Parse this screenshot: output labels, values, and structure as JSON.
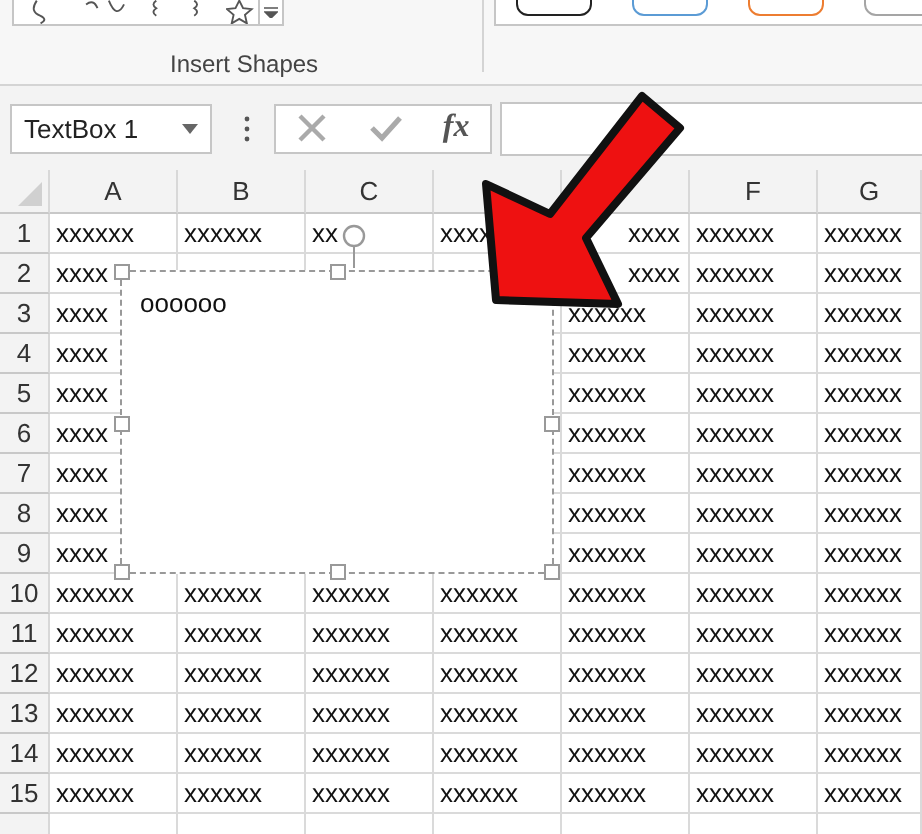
{
  "ribbon": {
    "group_label": "Insert Shapes",
    "style_swatches": [
      {
        "color": "#222222"
      },
      {
        "color": "#5b9bd5"
      },
      {
        "color": "#ed7d31"
      },
      {
        "color": "#a5a5a5"
      }
    ]
  },
  "formula_bar": {
    "name_box": "TextBox 1",
    "function_label": "fx"
  },
  "columns": [
    {
      "label": "A"
    },
    {
      "label": "B"
    },
    {
      "label": "C"
    },
    {},
    {},
    {
      "label": "F"
    },
    {
      "label": "G"
    }
  ],
  "rows": [
    {
      "number": "1",
      "cells": [
        "xxxxxx",
        "xxxxxx",
        "xx",
        "xxxx",
        "xxxx",
        "xxxxxx",
        "xxxxxx"
      ]
    },
    {
      "number": "2",
      "cells": [
        "xxxx",
        null,
        null,
        null,
        "xxxx",
        "xxxxxx",
        "xxxxxx"
      ]
    },
    {
      "number": "3",
      "cells": [
        "xxxx",
        null,
        null,
        null,
        "xxxxxx",
        "xxxxxx",
        "xxxxxx"
      ]
    },
    {
      "number": "4",
      "cells": [
        "xxxx",
        null,
        null,
        null,
        "xxxxxx",
        "xxxxxx",
        "xxxxxx"
      ]
    },
    {
      "number": "5",
      "cells": [
        "xxxx",
        null,
        null,
        null,
        "xxxxxx",
        "xxxxxx",
        "xxxxxx"
      ]
    },
    {
      "number": "6",
      "cells": [
        "xxxx",
        null,
        null,
        null,
        "xxxxxx",
        "xxxxxx",
        "xxxxxx"
      ]
    },
    {
      "number": "7",
      "cells": [
        "xxxx",
        null,
        null,
        null,
        "xxxxxx",
        "xxxxxx",
        "xxxxxx"
      ]
    },
    {
      "number": "8",
      "cells": [
        "xxxx",
        null,
        null,
        null,
        "xxxxxx",
        "xxxxxx",
        "xxxxxx"
      ]
    },
    {
      "number": "9",
      "cells": [
        "xxxx",
        null,
        null,
        null,
        "xxxxxx",
        "xxxxxx",
        "xxxxxx"
      ]
    },
    {
      "number": "10",
      "cells": [
        "xxxxxx",
        "xxxxxx",
        "xxxxxx",
        "xxxxxx",
        "xxxxxx",
        "xxxxxx",
        "xxxxxx"
      ]
    },
    {
      "number": "11",
      "cells": [
        "xxxxxx",
        "xxxxxx",
        "xxxxxx",
        "xxxxxx",
        "xxxxxx",
        "xxxxxx",
        "xxxxxx"
      ]
    },
    {
      "number": "12",
      "cells": [
        "xxxxxx",
        "xxxxxx",
        "xxxxxx",
        "xxxxxx",
        "xxxxxx",
        "xxxxxx",
        "xxxxxx"
      ]
    },
    {
      "number": "13",
      "cells": [
        "xxxxxx",
        "xxxxxx",
        "xxxxxx",
        "xxxxxx",
        "xxxxxx",
        "xxxxxx",
        "xxxxxx"
      ]
    },
    {
      "number": "14",
      "cells": [
        "xxxxxx",
        "xxxxxx",
        "xxxxxx",
        "xxxxxx",
        "xxxxxx",
        "xxxxxx",
        "xxxxxx"
      ]
    },
    {
      "number": "15",
      "cells": [
        "xxxxxx",
        "xxxxxx",
        "xxxxxx",
        "xxxxxx",
        "xxxxxx",
        "xxxxxx",
        "xxxxxx"
      ]
    }
  ],
  "text_box": {
    "text": "oooooo",
    "selected": true
  }
}
